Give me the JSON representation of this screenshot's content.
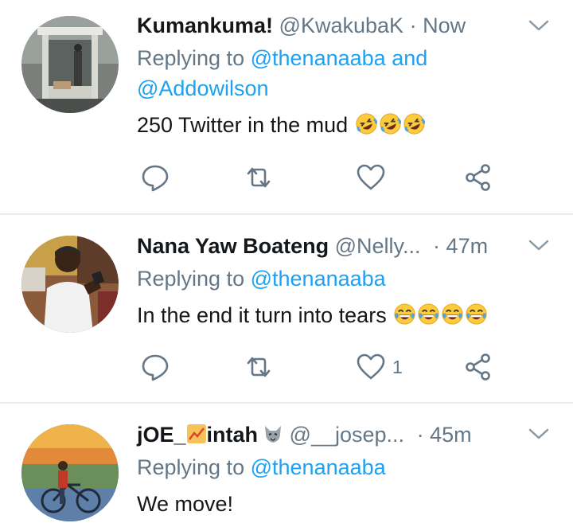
{
  "tweets": [
    {
      "name": "Kumankuma!",
      "handle": "@KwakubaK",
      "separator": "·",
      "time": "Now",
      "replying_prefix": "Replying to",
      "mentions": [
        "@thenanaaba",
        "@Addowilson"
      ],
      "mention_joiner": "and",
      "text": "250 Twitter in the mud",
      "emojis": [
        "rolling-on-floor-laughing",
        "rolling-on-floor-laughing",
        "rolling-on-floor-laughing"
      ],
      "like_count": ""
    },
    {
      "name": "Nana Yaw Boateng",
      "handle": "@Nelly...",
      "separator": "·",
      "time": "47m",
      "replying_prefix": "Replying to",
      "mentions": [
        "@thenanaaba"
      ],
      "text": "In the end it turn into tears",
      "emojis": [
        "tears-of-joy",
        "tears-of-joy",
        "tears-of-joy",
        "tears-of-joy"
      ],
      "like_count": "1"
    },
    {
      "name_part1": "jOE_",
      "name_part2": "intah",
      "handle": "@__josep...",
      "separator": "·",
      "time": "45m",
      "replying_prefix": "Replying to",
      "mentions": [
        "@thenanaaba"
      ],
      "text": "We move!"
    }
  ],
  "colors": {
    "accent": "#1da1f2",
    "muted": "#657786",
    "divider": "#e6ecf0"
  }
}
